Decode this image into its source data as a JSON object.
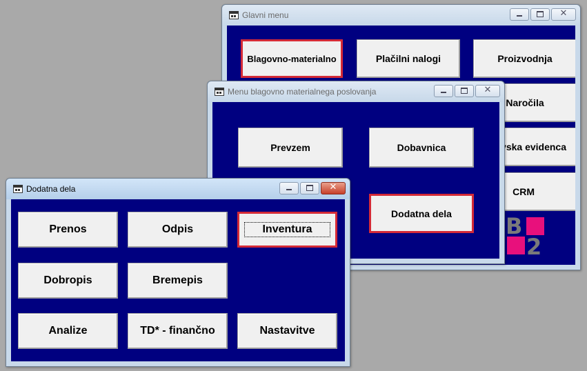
{
  "windows": {
    "glavni": {
      "title": "Glavni menu",
      "buttons": {
        "blagovno": "Blagovno-materialno",
        "placilni": "Plačilni nalogi",
        "proizvodnja": "Proizvodnja",
        "narocila": "Naročila",
        "evidenca": "ovska evidenca",
        "crm": "CRM"
      },
      "logo": {
        "letter_top": "B",
        "letter_bottom": "2",
        "accent_color": "#e8107c"
      }
    },
    "blagovno": {
      "title": "Menu blagovno materialnega poslovanja",
      "buttons": {
        "prevzem": "Prevzem",
        "dobavnica": "Dobavnica",
        "dodatna": "Dodatna dela"
      }
    },
    "dodatna": {
      "title": "Dodatna dela",
      "buttons": {
        "prenos": "Prenos",
        "odpis": "Odpis",
        "inventura": "Inventura",
        "dobropis": "Dobropis",
        "bremepis": "Bremepis",
        "analize": "Analize",
        "td_financno": "TD* - finančno",
        "nastavitve": "Nastavitve"
      }
    }
  },
  "controls": {
    "minimize": "",
    "maximize": "",
    "close": "✕"
  },
  "colors": {
    "client_background": "#000080",
    "selection_border": "#d42a37",
    "desktop": "#a9a9a9"
  }
}
